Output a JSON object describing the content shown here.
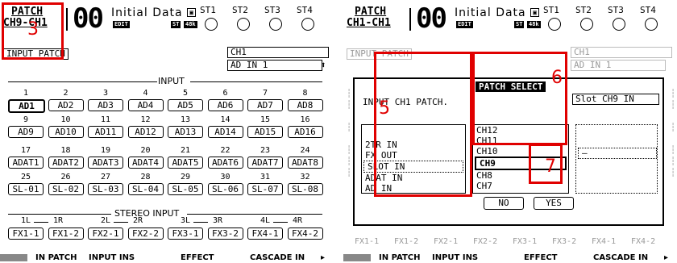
{
  "left": {
    "header": {
      "patch_line1": "PATCH",
      "patch_line2": "CH9-CH1",
      "scene_number": "00",
      "scene_title": "Initial Data",
      "edit_tag": "EDIT",
      "st_tag": "ST",
      "rate_tag": "48k",
      "st_labels": [
        "ST1",
        "ST2",
        "ST3",
        "ST4"
      ]
    },
    "page_label": "INPUT PATCH",
    "channel_name": "CH1",
    "channel_source": "AD IN 1",
    "input_title": "INPUT",
    "ad_numbers": [
      "1",
      "2",
      "3",
      "4",
      "5",
      "6",
      "7",
      "8",
      "9",
      "10",
      "11",
      "12",
      "13",
      "14",
      "15",
      "16"
    ],
    "ad_slots": [
      "AD1",
      "AD2",
      "AD3",
      "AD4",
      "AD5",
      "AD6",
      "AD7",
      "AD8",
      "AD9",
      "AD10",
      "AD11",
      "AD12",
      "AD13",
      "AD14",
      "AD15",
      "AD16"
    ],
    "adat_numbers": [
      "17",
      "18",
      "19",
      "20",
      "21",
      "22",
      "23",
      "24",
      "25",
      "26",
      "27",
      "28",
      "29",
      "30",
      "31",
      "32"
    ],
    "adat_slots": [
      "ADAT1",
      "ADAT2",
      "ADAT3",
      "ADAT4",
      "ADAT5",
      "ADAT6",
      "ADAT7",
      "ADAT8",
      "SL-01",
      "SL-02",
      "SL-03",
      "SL-04",
      "SL-05",
      "SL-06",
      "SL-07",
      "SL-08"
    ],
    "stereo_title": "STEREO INPUT",
    "stereo_pairs": [
      [
        "1L",
        "1R"
      ],
      [
        "2L",
        "2R"
      ],
      [
        "3L",
        "3R"
      ],
      [
        "4L",
        "4R"
      ]
    ],
    "fx_slots": [
      "FX1-1",
      "FX1-2",
      "FX2-1",
      "FX2-2",
      "FX3-1",
      "FX3-2",
      "FX4-1",
      "FX4-2"
    ],
    "annotation": "3"
  },
  "right": {
    "header": {
      "patch_line1": "PATCH",
      "patch_line2": "CH1-CH1",
      "scene_number": "00",
      "scene_title": "Initial Data",
      "edit_tag": "EDIT",
      "st_tag": "ST",
      "rate_tag": "48k",
      "st_labels": [
        "ST1",
        "ST2",
        "ST3",
        "ST4"
      ]
    },
    "page_label": "INPUT PATCH",
    "channel_name": "CH1",
    "channel_source": "AD IN 1",
    "dialog": {
      "title": "PATCH SELECT",
      "prompt": "INPUT CH1 PATCH",
      "current": "Slot CH9 IN",
      "sources": [
        "2TR IN",
        "FX OUT",
        "SLOT IN",
        "ADAT IN",
        "AD IN"
      ],
      "selected_source": "SLOT IN",
      "channels": [
        "CH12",
        "CH11",
        "CH10",
        "CH9",
        "CH8",
        "CH7"
      ],
      "selected_channel": "CH9",
      "extra": "–",
      "no_label": "NO",
      "yes_label": "YES"
    },
    "annotations": [
      "5",
      "6",
      "7"
    ],
    "bottom_faded": [
      "FX1-1",
      "FX1-2",
      "FX2-1",
      "FX2-2",
      "FX3-1",
      "FX3-2",
      "FX4-1",
      "FX4-2"
    ]
  },
  "tabs": [
    "IN PATCH",
    "INPUT INS",
    "EFFECT",
    "CASCADE IN"
  ],
  "colors": {
    "annotation": "#e00000",
    "lcd_text": "#000000",
    "faded": "#9a9a9a"
  }
}
